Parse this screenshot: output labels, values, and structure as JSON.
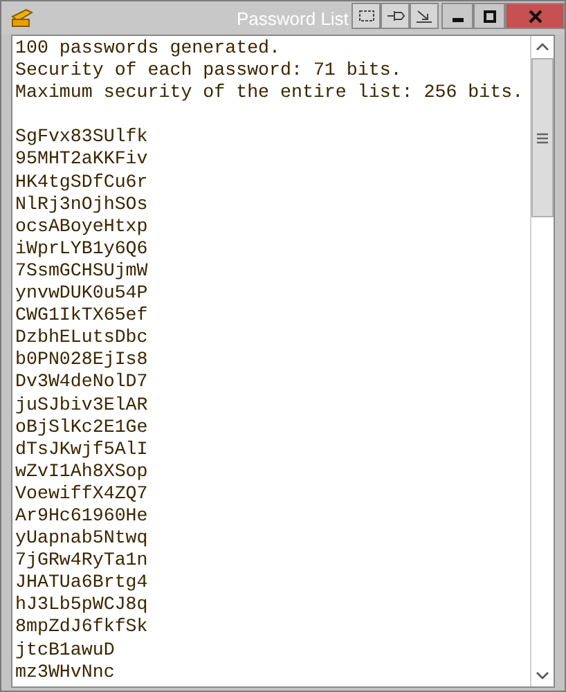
{
  "window": {
    "title": "Password List"
  },
  "text": {
    "header_lines": [
      "100 passwords generated.",
      "Security of each password: 71 bits.",
      "Maximum security of the entire list: 256 bits."
    ],
    "passwords": [
      "SgFvx83SUlfk",
      "95MHT2aKKFiv",
      "HK4tgSDfCu6r",
      "NlRj3nOjhSOs",
      "ocsABoyeHtxp",
      "iWprLYB1y6Q6",
      "7SsmGCHSUjmW",
      "ynvwDUK0u54P",
      "CWG1IkTX65ef",
      "DzbhELutsDbc",
      "b0PN028EjIs8",
      "Dv3W4deNolD7",
      "juSJbiv3ElAR",
      "oBjSlKc2E1Ge",
      "dTsJKwjf5AlI",
      "wZvI1Ah8XSop",
      "VoewiffX4ZQ7",
      "Ar9Hc61960He",
      "yUapnab5Ntwq",
      "7jGRw4RyTa1n",
      "JHATUa6Brtg4",
      "hJ3Lb5pWCJ8q",
      "8mpZdJ6fkfSk",
      "jtcB1awuD",
      "mz3WHvNnc"
    ]
  }
}
